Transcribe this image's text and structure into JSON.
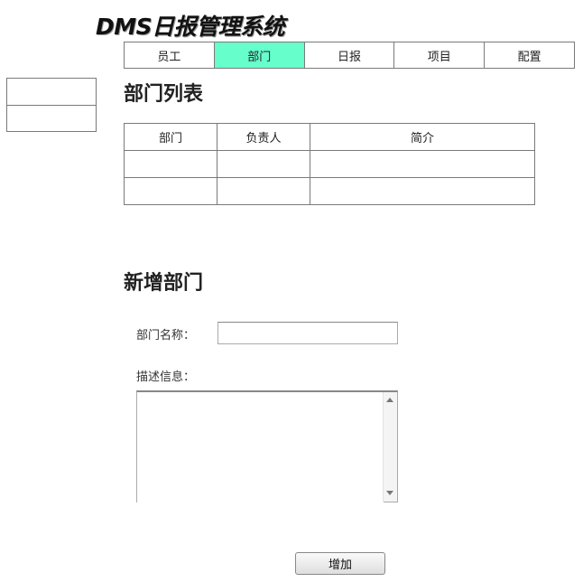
{
  "app": {
    "title": "DMS日报管理系统"
  },
  "nav": {
    "items": [
      {
        "label": "员工"
      },
      {
        "label": "部门"
      },
      {
        "label": "日报"
      },
      {
        "label": "项目"
      },
      {
        "label": "配置"
      }
    ],
    "active_index": 1,
    "active_color": "#66ffcc"
  },
  "dept_list": {
    "title": "部门列表",
    "columns": [
      "部门",
      "负责人",
      "简介"
    ],
    "rows": [
      [
        "",
        "",
        ""
      ],
      [
        "",
        "",
        ""
      ]
    ]
  },
  "add_dept": {
    "title": "新增部门",
    "name_label": "部门名称：",
    "name_value": "",
    "desc_label": "描述信息：",
    "desc_value": "",
    "submit_label": "增加"
  }
}
